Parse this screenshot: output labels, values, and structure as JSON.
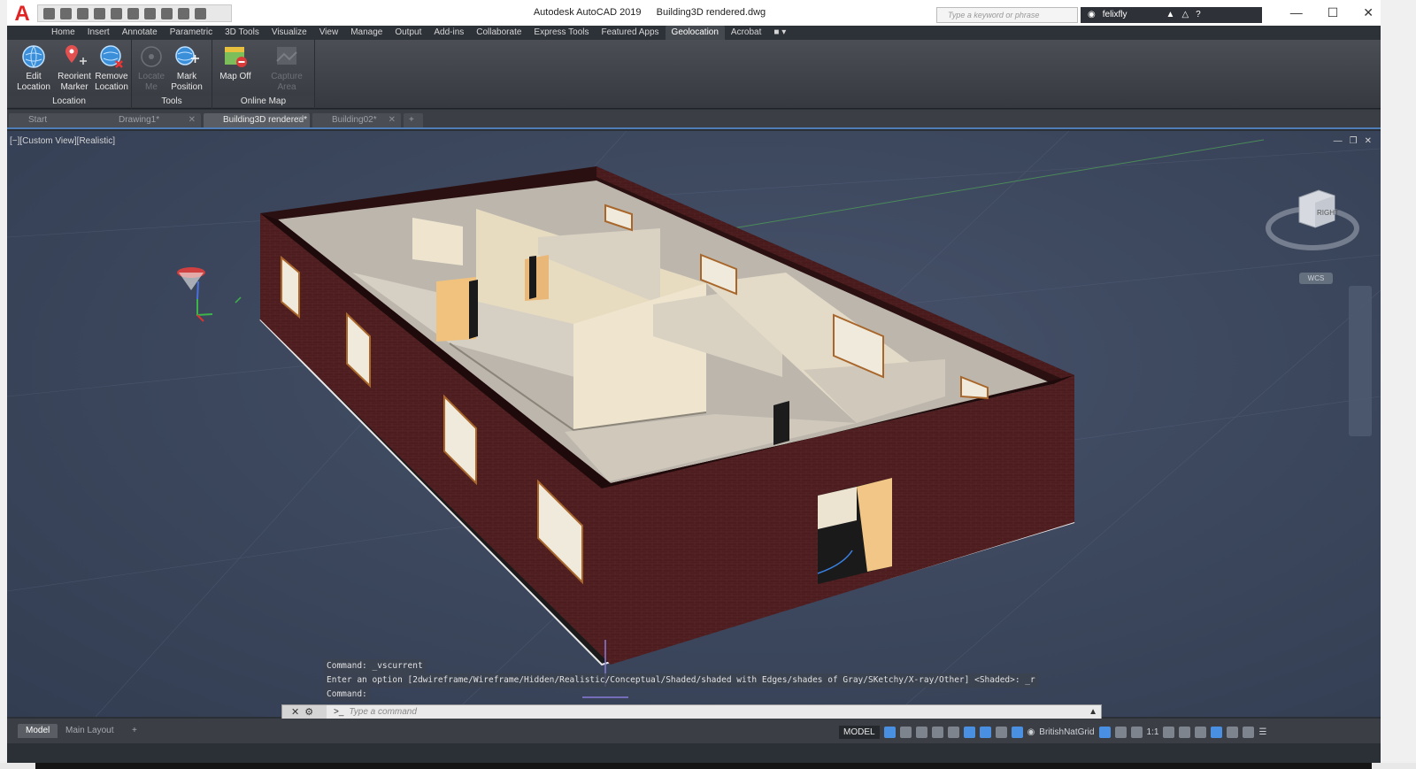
{
  "app": {
    "name": "Autodesk AutoCAD 2019",
    "file": "Building3D rendered.dwg",
    "logo": "A",
    "search_placeholder": "Type a keyword or phrase",
    "user": "felixfly"
  },
  "ribbon_tabs": [
    "Home",
    "Insert",
    "Annotate",
    "Parametric",
    "3D Tools",
    "Visualize",
    "View",
    "Manage",
    "Output",
    "Add-ins",
    "Collaborate",
    "Express Tools",
    "Featured Apps",
    "Geolocation",
    "Acrobat"
  ],
  "active_ribbon_tab": "Geolocation",
  "ribbon": {
    "panels": [
      {
        "label": "Location",
        "tools": [
          {
            "line1": "Edit",
            "line2": "Location"
          },
          {
            "line1": "Reorient",
            "line2": "Marker"
          },
          {
            "line1": "Remove",
            "line2": "Location"
          }
        ]
      },
      {
        "label": "Tools",
        "tools": [
          {
            "line1": "Locate",
            "line2": "Me",
            "disabled": true
          },
          {
            "line1": "Mark",
            "line2": "Position"
          }
        ]
      },
      {
        "label": "Online Map",
        "tools": [
          {
            "line1": "Map Off",
            "line2": ""
          },
          {
            "line1": "Capture",
            "line2": "Area",
            "disabled": true
          }
        ]
      }
    ]
  },
  "doc_tabs": [
    {
      "label": "Start"
    },
    {
      "label": "Drawing1*"
    },
    {
      "label": "Building3D rendered*",
      "active": true
    },
    {
      "label": "Building02*"
    }
  ],
  "viewport": {
    "label": "[−][Custom View][Realistic]",
    "viewcube_face": "RIGHT",
    "wcs": "WCS"
  },
  "command_history": [
    "Command: _vscurrent",
    "Enter an option [2dwireframe/Wireframe/Hidden/Realistic/Conceptual/Shaded/shaded with Edges/shades of Gray/SKetchy/X-ray/Other] <Shaded>: _r",
    "Command:"
  ],
  "command_line": {
    "placeholder": "Type a command",
    "prompt": ">_"
  },
  "layout_tabs": [
    "Model",
    "Main Layout"
  ],
  "status": {
    "model": "MODEL",
    "coordinate_system": "BritishNatGrid",
    "scale": "1:1"
  }
}
